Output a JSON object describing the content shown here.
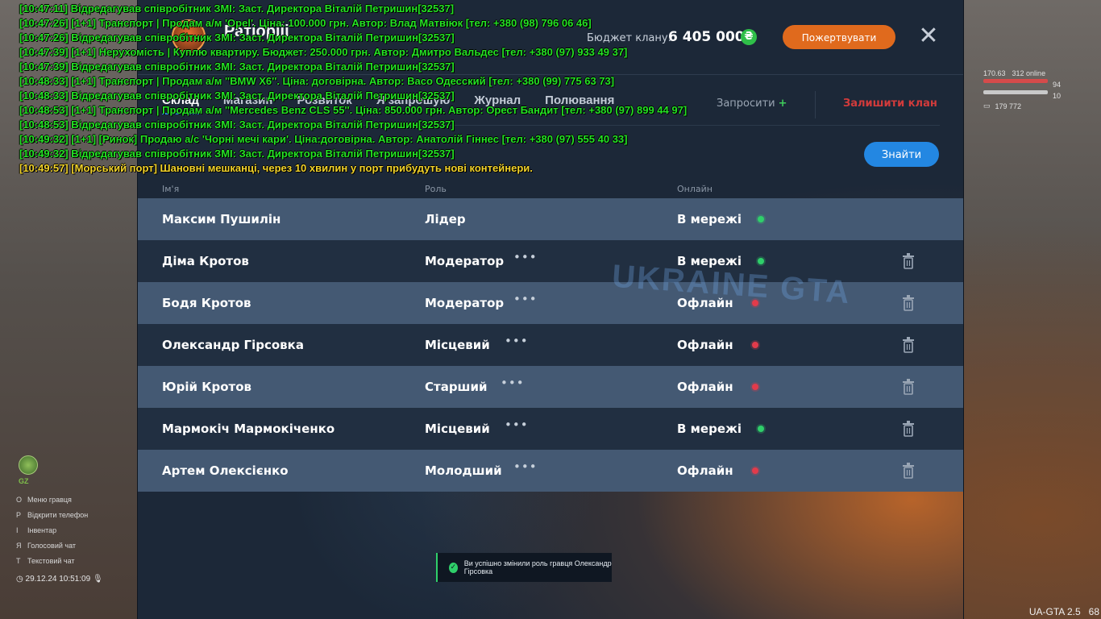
{
  "hud": {
    "gz_label": "GZ",
    "menu": [
      {
        "key": "O",
        "label": "Меню гравця"
      },
      {
        "key": "P",
        "label": "Відкрити телефон"
      },
      {
        "key": "I",
        "label": "Інвентар"
      },
      {
        "key": "Я",
        "label": "Голосовий чат"
      },
      {
        "key": "T",
        "label": "Текстовий чат"
      }
    ],
    "datetime": "29.12.24 10:51:09",
    "top_right_values": [
      "170.63",
      "312 online"
    ],
    "bars": [
      "94",
      "10",
      "179 772"
    ],
    "version": "UA-GTA 2.5",
    "fps": "68"
  },
  "panel": {
    "clan_name": "Ратіорііі",
    "budget_label": "Бюджет клану:",
    "budget_value": "6 405 000",
    "currency_symbol": "₴",
    "donate_label": "Пожертвувати",
    "close_symbol": "✕",
    "tabs": [
      {
        "label": "Склад",
        "active": true
      },
      {
        "label": "Магазин",
        "active": false
      },
      {
        "label": "Розвиток",
        "active": false
      },
      {
        "label": "Я запрошую",
        "active": false
      },
      {
        "label": "Журнал",
        "active": false
      },
      {
        "label": "Полювання",
        "active": false
      }
    ],
    "invite_label": "Запросити",
    "invite_plus": "+",
    "leave_label": "Залишити клан",
    "find_label": "Знайти",
    "columns": {
      "name": "Ім'я",
      "role": "Роль",
      "online": "Онлайн"
    },
    "members": [
      {
        "name": "Максим Пушилін",
        "role": "Лідер",
        "status": "В мережі",
        "online": true,
        "menu": false,
        "deletable": false
      },
      {
        "name": "Діма Кротов",
        "role": "Модератор",
        "status": "В мережі",
        "online": true,
        "menu": true,
        "deletable": true
      },
      {
        "name": "Бодя Кротов",
        "role": "Модератор",
        "status": "Офлайн",
        "online": false,
        "menu": true,
        "deletable": true
      },
      {
        "name": "Олександр Гірсовка",
        "role": "Місцевий",
        "status": "Офлайн",
        "online": false,
        "menu": true,
        "deletable": true
      },
      {
        "name": "Юрій Кротов",
        "role": "Старший",
        "status": "Офлайн",
        "online": false,
        "menu": true,
        "deletable": true
      },
      {
        "name": "Мармокіч Мармокіченко",
        "role": "Місцевий",
        "status": "В мережі",
        "online": true,
        "menu": true,
        "deletable": true
      },
      {
        "name": "Артем Олексієнко",
        "role": "Молодший",
        "status": "Офлайн",
        "online": false,
        "menu": true,
        "deletable": true
      }
    ],
    "menu_symbol": "•••",
    "watermark": "UKRAINE GTA",
    "toast": "Ви успішно змінили роль гравця Олександр Гірсовка"
  },
  "chat": [
    {
      "text": "[10:47:11]  Відредагував співробітник ЗМІ: Заст. Директора Віталій Петришин[32537]",
      "color": "green"
    },
    {
      "text": "[10:47:26] [1+1] Транспорт | Продам а/м 'Opel'. Ціна: 100.000 грн. Автор: Влад Матвіюк [тел: +380 (98) 796 06 46]",
      "color": "green"
    },
    {
      "text": "[10:47:26]  Відредагував співробітник ЗМІ: Заст. Директора Віталій Петришин[32537]",
      "color": "green"
    },
    {
      "text": "[10:47:39] [1+1] Нерухомість | Куплю квартиру. Бюджет: 250.000 грн. Автор: Дмитро Вальдес [тел: +380 (97) 933 49 37]",
      "color": "green"
    },
    {
      "text": "[10:47:39]  Відредагував співробітник ЗМІ: Заст. Директора Віталій Петришин[32537]",
      "color": "green"
    },
    {
      "text": "[10:48:33] [1+1] Транспорт | Продам а/м ''BMW X6''. Ціна: договірна. Автор: Васо Одесский [тел: +380 (99) 775 63 73]",
      "color": "green"
    },
    {
      "text": "[10:48:33]  Відредагував співробітник ЗМІ: Заст. Директора Віталій Петришин[32537]",
      "color": "green"
    },
    {
      "text": "[10:48:53] [1+1] Транспорт | Продам а/м ''Mercedes Benz CLS 55''. Ціна: 850.000 грн. Автор: Орест Бандит [тел: +380 (97) 899 44 97]",
      "color": "green"
    },
    {
      "text": "[10:48:53]  Відредагував співробітник ЗМІ: Заст. Директора Віталій Петришин[32537]",
      "color": "green"
    },
    {
      "text": "[10:49:32] [1+1] [Ринок] Продаю а/с 'Чорні мечі кари'. Ціна:договірна. Автор: Анатолій Гіннес [тел: +380 (97) 555 40 33]",
      "color": "green"
    },
    {
      "text": "[10:49:32]  Відредагував співробітник ЗМІ: Заст. Директора Віталій Петришин[32537]",
      "color": "green"
    },
    {
      "text": "[10:49:57] [Морський порт] Шановні мешканці, через 10 хвилин у порт прибудуть нові контейнери.",
      "color": "yellow"
    }
  ],
  "colors": {
    "panel_bg": "#1c2838",
    "row_light": "#445973",
    "row_dark": "#212f41",
    "accent_blue": "#2387e2",
    "donate_orange": "#e06a1d",
    "online_green": "#2fcf6a",
    "offline_red": "#e23b4b",
    "leave_red": "#d23b3b",
    "chat_green": "#24e324",
    "chat_yellow": "#f2d32b"
  }
}
